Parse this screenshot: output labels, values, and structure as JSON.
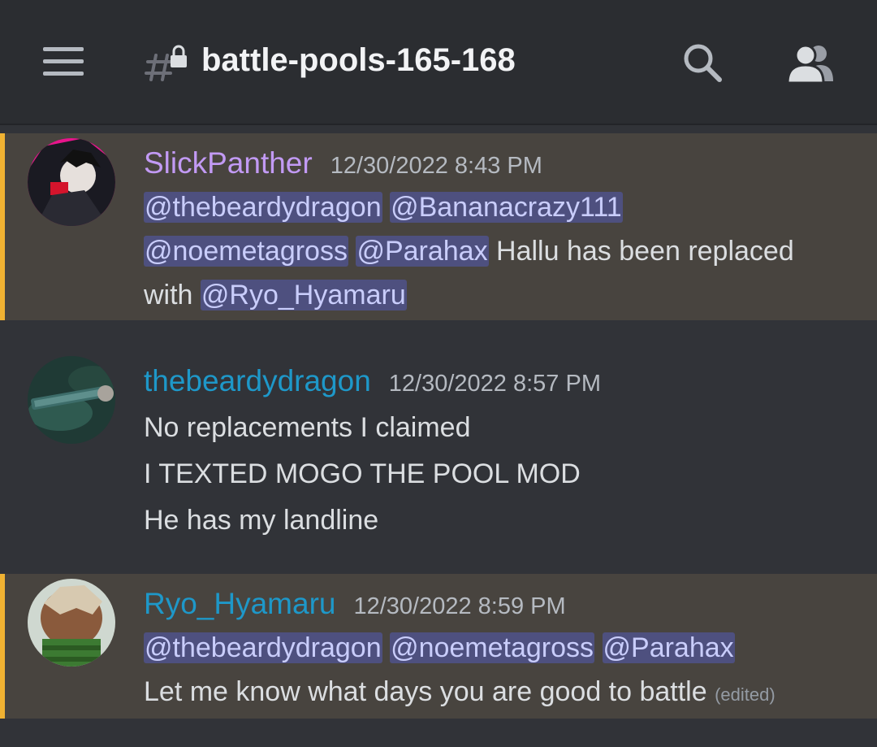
{
  "header": {
    "channel_name": "battle-pools-165-168",
    "icons": {
      "menu": "hamburger-menu-icon",
      "channel": "locked-thread-hash-icon",
      "search": "search-icon",
      "members": "members-icon"
    }
  },
  "messages": [
    {
      "username": "SlickPanther",
      "username_color": "#c29af4",
      "timestamp": "12/30/2022 8:43 PM",
      "highlighted": true,
      "lines": [
        [
          {
            "type": "mention",
            "text": "@thebeardydragon"
          },
          {
            "type": "text",
            "text": " "
          },
          {
            "type": "mention",
            "text": "@Bananacrazy111"
          }
        ],
        [
          {
            "type": "mention",
            "text": "@noemetagross"
          },
          {
            "type": "text",
            "text": " "
          },
          {
            "type": "mention",
            "text": "@Parahax"
          },
          {
            "type": "text",
            "text": " Hallu has been replaced"
          }
        ],
        [
          {
            "type": "text",
            "text": "with "
          },
          {
            "type": "mention",
            "text": "@Ryo_Hyamaru"
          }
        ]
      ]
    },
    {
      "username": "thebeardydragon",
      "username_color": "#1e98c9",
      "timestamp": "12/30/2022 8:57 PM",
      "highlighted": false,
      "lines": [
        [
          {
            "type": "text",
            "text": "No replacements I claimed"
          }
        ],
        [
          {
            "type": "text",
            "text": "I TEXTED MOGO THE POOL MOD"
          }
        ],
        [
          {
            "type": "text",
            "text": "He has my landline"
          }
        ]
      ]
    },
    {
      "username": "Ryo_Hyamaru",
      "username_color": "#1e98c9",
      "timestamp": "12/30/2022 8:59 PM",
      "highlighted": true,
      "edited_label": "(edited)",
      "lines": [
        [
          {
            "type": "mention",
            "text": "@thebeardydragon"
          },
          {
            "type": "text",
            "text": " "
          },
          {
            "type": "mention",
            "text": "@noemetagross"
          },
          {
            "type": "text",
            "text": " "
          },
          {
            "type": "mention",
            "text": "@Parahax"
          }
        ],
        [
          {
            "type": "text",
            "text": "Let me know what days you are good to battle"
          }
        ]
      ]
    }
  ],
  "colors": {
    "background": "#313338",
    "topbar": "#2b2d31",
    "highlight_bg": "#48443f",
    "highlight_bar": "#f0b232",
    "mention_bg": "#4e507f",
    "mention_text": "#c9cdfb",
    "message_text": "#dbdee1",
    "timestamp": "#b5bac1"
  }
}
